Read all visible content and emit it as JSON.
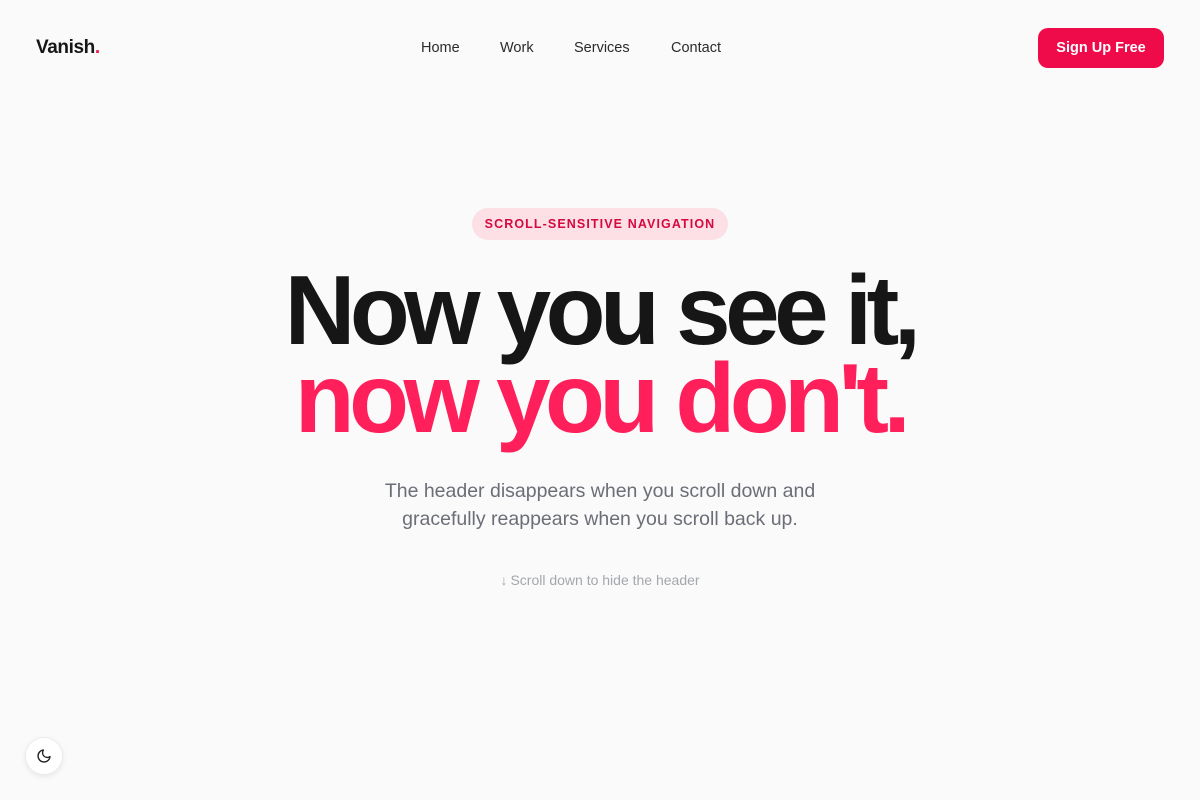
{
  "header": {
    "logo_text": "Vanish",
    "logo_dot": ".",
    "nav": [
      {
        "label": "Home"
      },
      {
        "label": "Work"
      },
      {
        "label": "Services"
      },
      {
        "label": "Contact"
      }
    ],
    "cta_label": "Sign Up Free"
  },
  "hero": {
    "badge": "SCROLL-SENSITIVE NAVIGATION",
    "headline_line1": "Now you see it,",
    "headline_line2": "now you don't.",
    "subtitle_line1": "The header disappears when you scroll down and",
    "subtitle_line2": "gracefully reappears when you scroll back up.",
    "hint_arrow": "↓",
    "hint_text": "Scroll down to hide the header"
  },
  "theme_toggle": {
    "icon": "moon-icon"
  },
  "colors": {
    "accent": "#ef0a4a",
    "accent_text": "#ff1f5a",
    "badge_bg": "#fde0e6",
    "text_dark": "#161616",
    "text_muted": "#6b6e76",
    "background": "#fafafa"
  }
}
